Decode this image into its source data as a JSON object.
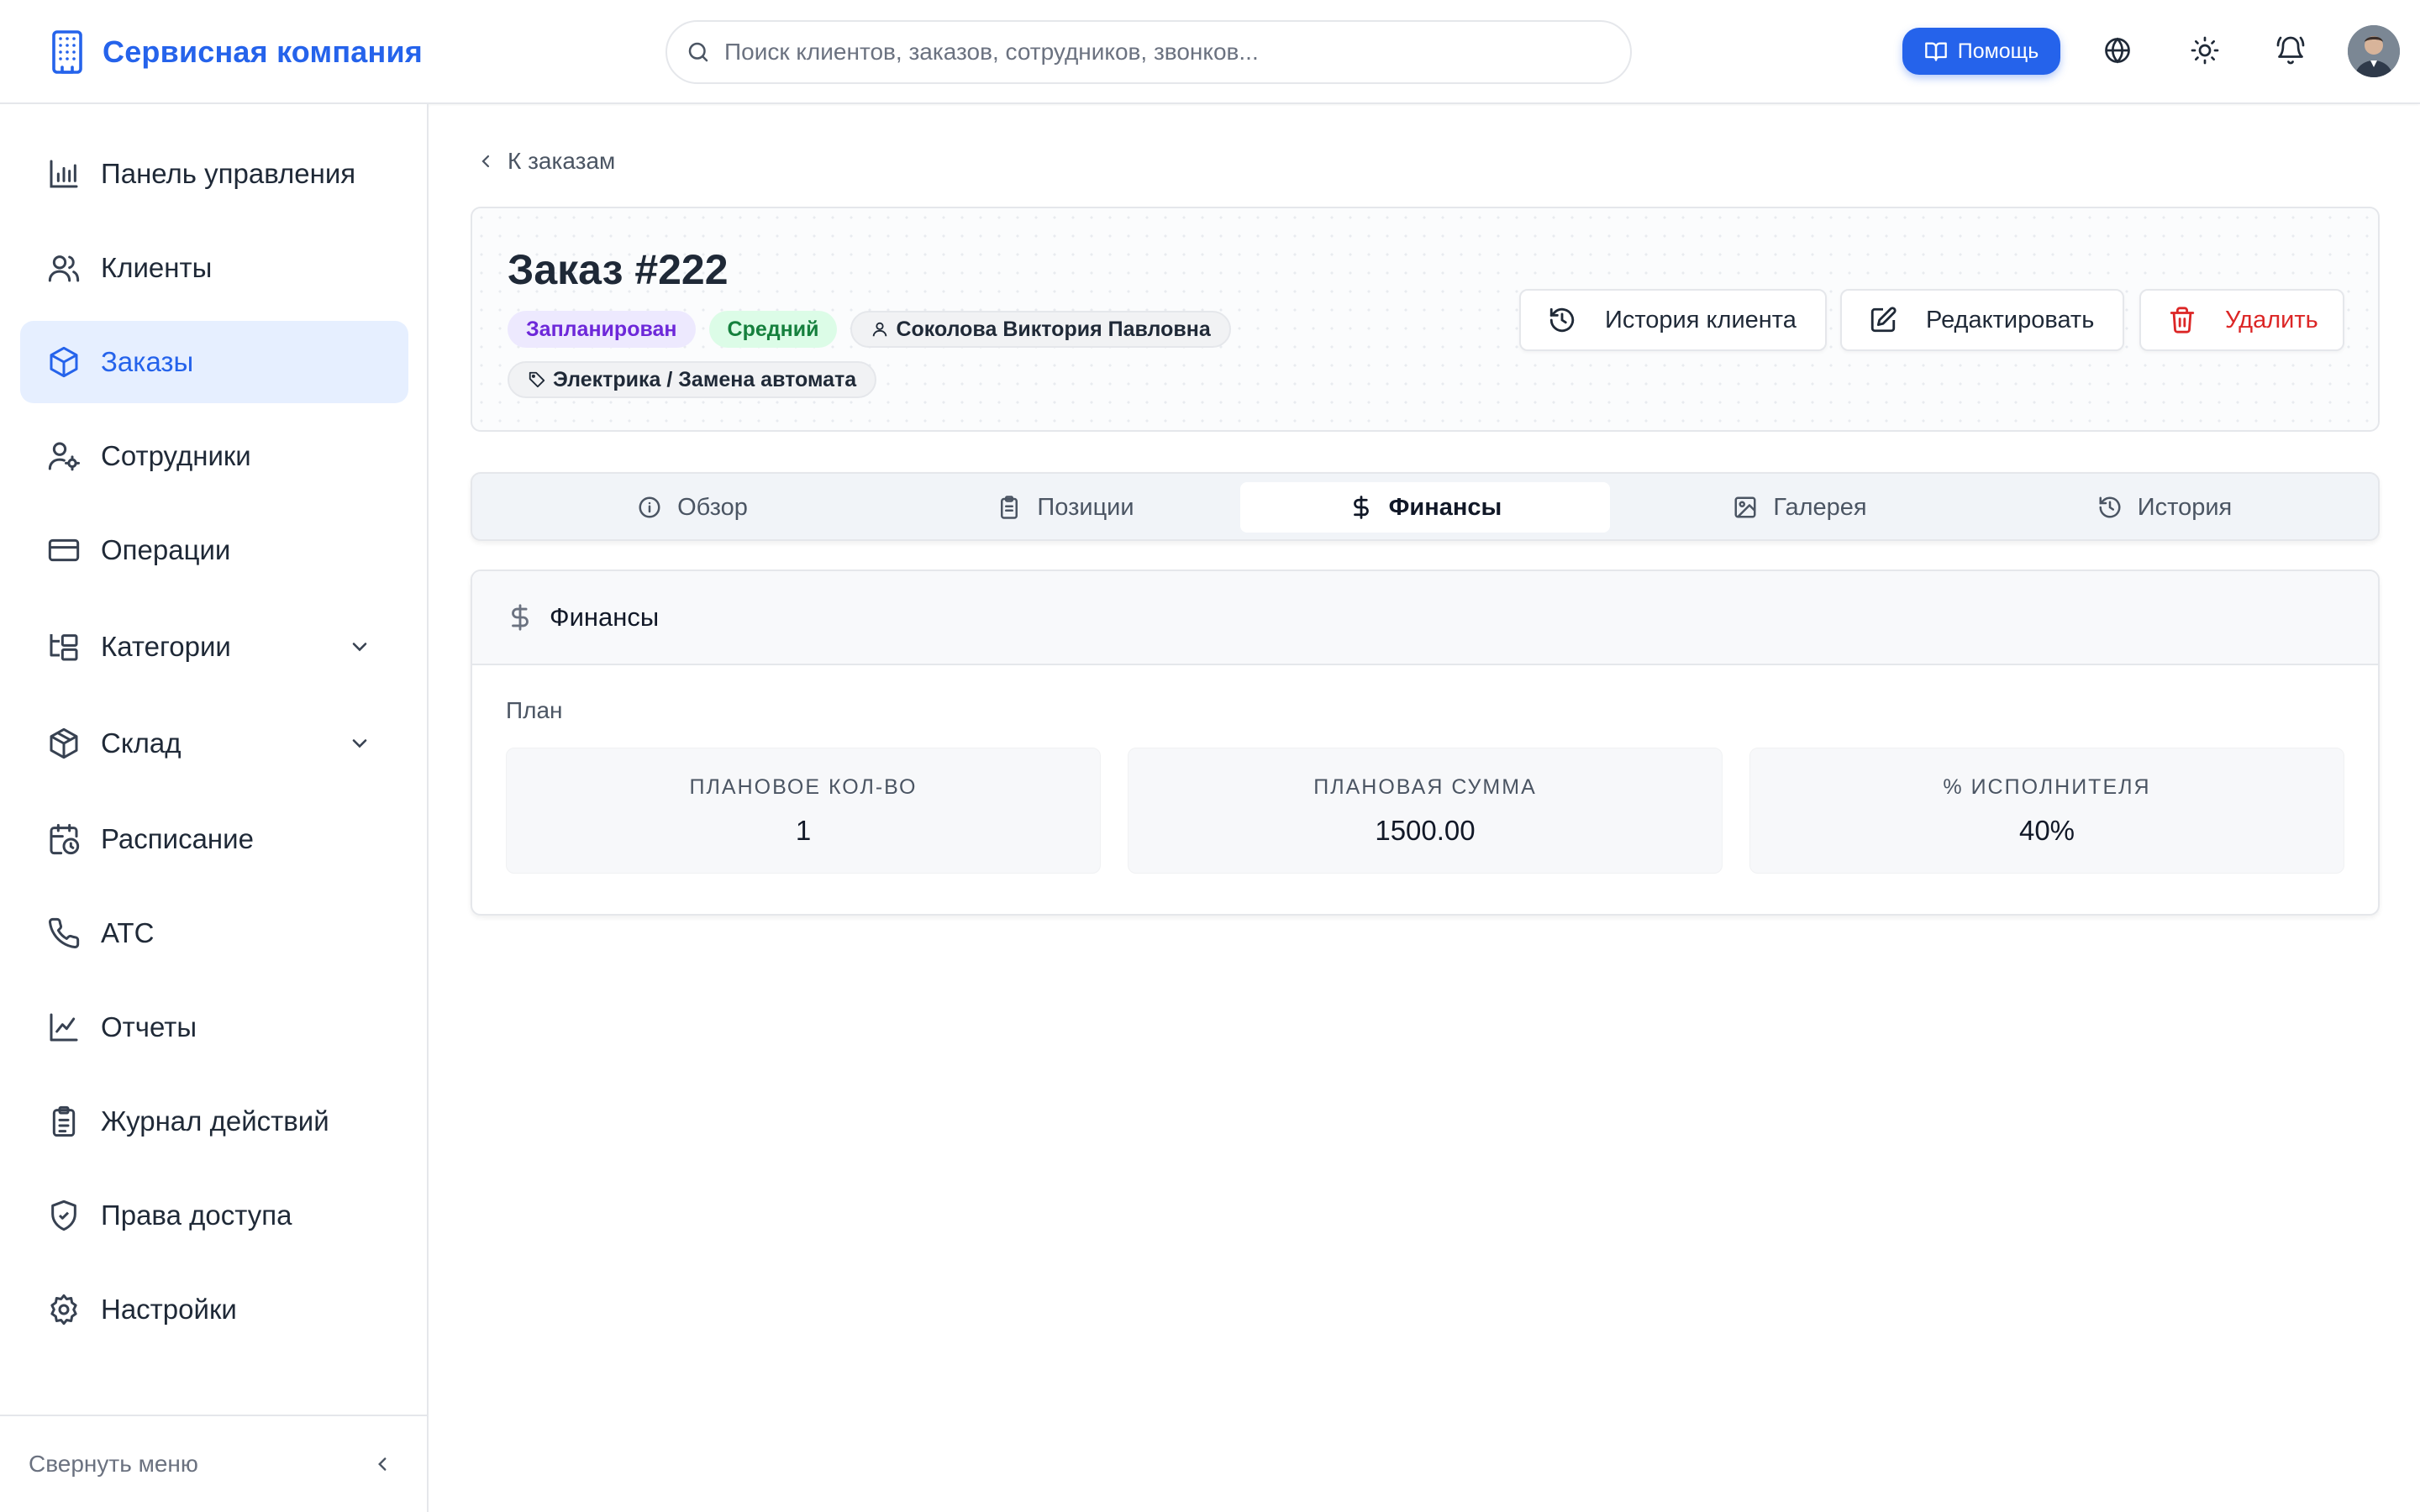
{
  "app": {
    "title": "Сервисная компания"
  },
  "search": {
    "placeholder": "Поиск клиентов, заказов, сотрудников, звонков..."
  },
  "header": {
    "help_label": "Помощь"
  },
  "sidebar": {
    "items": [
      {
        "label": "Панель управления",
        "icon": "bar-chart-icon"
      },
      {
        "label": "Клиенты",
        "icon": "users-icon"
      },
      {
        "label": "Заказы",
        "icon": "package-icon",
        "active": true
      },
      {
        "label": "Сотрудники",
        "icon": "user-cog-icon"
      },
      {
        "label": "Операции",
        "icon": "credit-card-icon"
      },
      {
        "label": "Категории",
        "icon": "folder-tree-icon",
        "expandable": true
      },
      {
        "label": "Склад",
        "icon": "box-icon",
        "expandable": true
      },
      {
        "label": "Расписание",
        "icon": "calendar-clock-icon"
      },
      {
        "label": "АТС",
        "icon": "phone-icon"
      },
      {
        "label": "Отчеты",
        "icon": "line-chart-icon"
      },
      {
        "label": "Журнал действий",
        "icon": "clipboard-list-icon"
      },
      {
        "label": "Права доступа",
        "icon": "shield-check-icon"
      },
      {
        "label": "Настройки",
        "icon": "settings-icon"
      }
    ],
    "collapse_label": "Свернуть меню"
  },
  "order": {
    "back_label": "К заказам",
    "title": "Заказ #222",
    "status": "Запланирован",
    "priority": "Средний",
    "assignee": "Соколова Виктория Павловна",
    "category": "Электрика / Замена автомата",
    "actions": {
      "history": "История клиента",
      "edit": "Редактировать",
      "delete": "Удалить"
    },
    "colors": {
      "status": "#6d28d9",
      "priority": "#15803d",
      "delete": "#dc2626"
    }
  },
  "tabs": [
    {
      "label": "Обзор",
      "icon": "info-icon"
    },
    {
      "label": "Позиции",
      "icon": "clipboard-icon"
    },
    {
      "label": "Финансы",
      "icon": "dollar-icon",
      "active": true
    },
    {
      "label": "Галерея",
      "icon": "image-icon"
    },
    {
      "label": "История",
      "icon": "history-icon"
    }
  ],
  "finance": {
    "title": "Финансы",
    "section_label": "План",
    "stats": [
      {
        "label": "ПЛАНОВОЕ КОЛ-ВО",
        "value": "1"
      },
      {
        "label": "ПЛАНОВАЯ СУММА",
        "value": "1500.00"
      },
      {
        "label": "% ИСПОЛНИТЕЛЯ",
        "value": "40%"
      }
    ]
  },
  "theme": {
    "accent": "#2563eb",
    "active_nav_bg": "#e6efff"
  }
}
